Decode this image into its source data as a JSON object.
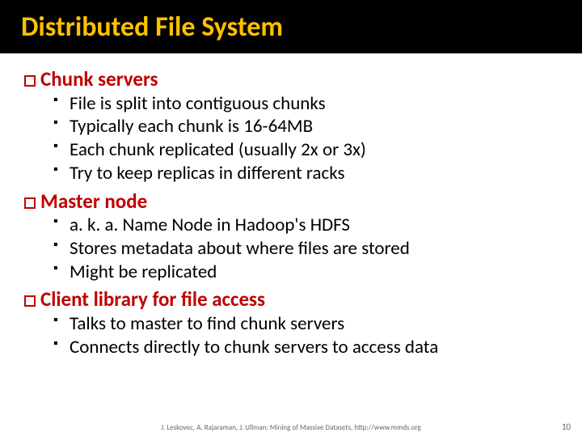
{
  "title": "Distributed File System",
  "sections": [
    {
      "heading": "Chunk servers",
      "items": [
        "File is split into contiguous chunks",
        "Typically each chunk is 16-64MB",
        "Each chunk replicated (usually 2x or 3x)",
        "Try to keep replicas in different racks"
      ]
    },
    {
      "heading": "Master node",
      "items": [
        "a. k. a. Name Node in Hadoop's HDFS",
        "Stores metadata about where files are stored",
        "Might be replicated"
      ]
    },
    {
      "heading": "Client library for file access",
      "items": [
        "Talks to master to find chunk servers",
        "Connects directly to chunk servers to access data"
      ]
    }
  ],
  "footer": "J. Leskovec, A. Rajaraman, J. Ullman: Mining of Massive Datasets, http://www.mmds.org",
  "page_number": "10"
}
